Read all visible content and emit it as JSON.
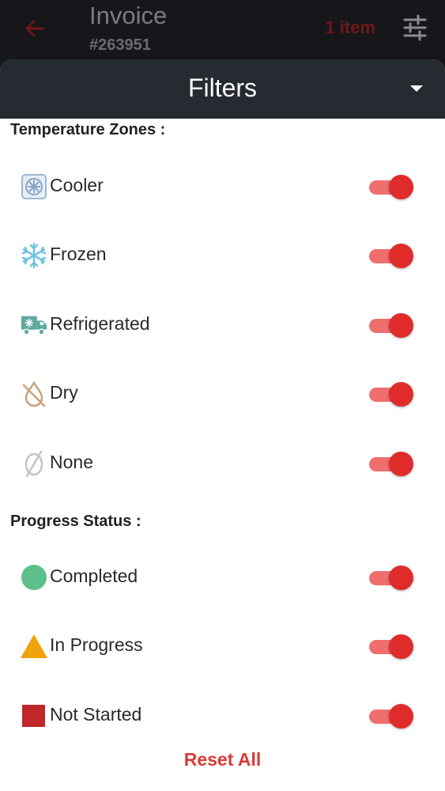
{
  "header": {
    "title": "Invoice",
    "invoice_number": "#263951",
    "items_count": "1 item"
  },
  "sheet": {
    "title": "Filters",
    "temperature_section": "Temperature Zones :",
    "temperature_zones": [
      {
        "label": "Cooler",
        "icon": "cooler-icon",
        "enabled": true
      },
      {
        "label": "Frozen",
        "icon": "snowflake-icon",
        "enabled": true
      },
      {
        "label": "Refrigerated",
        "icon": "refrigerated-truck-icon",
        "enabled": true
      },
      {
        "label": "Dry",
        "icon": "dry-icon",
        "enabled": true
      },
      {
        "label": "None",
        "icon": "none-icon",
        "enabled": true
      }
    ],
    "progress_section": "Progress Status :",
    "progress_statuses": [
      {
        "label": "Completed",
        "icon": "green-circle-icon",
        "color": "#5dbf8a",
        "enabled": true
      },
      {
        "label": "In Progress",
        "icon": "orange-triangle-icon",
        "color": "#f0a30a",
        "enabled": true
      },
      {
        "label": "Not Started",
        "icon": "red-square-icon",
        "color": "#c0262a",
        "enabled": true
      }
    ],
    "reset_label": "Reset All"
  },
  "colors": {
    "accent": "#e02b2b",
    "track": "#ef6e6e",
    "header_bg": "#262a31"
  }
}
